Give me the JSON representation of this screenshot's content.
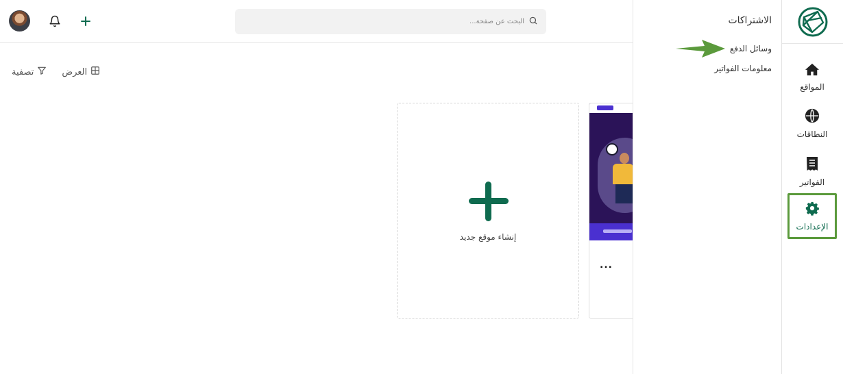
{
  "topbar": {
    "search_placeholder": "البحث عن صفحة..."
  },
  "toolbar": {
    "view_label": "العرض",
    "filter_label": "تصفية"
  },
  "cards": {
    "new_site_label": "إنشاء موقع جديد",
    "more_label": "..."
  },
  "settings_panel": {
    "title": "الاشتراكات",
    "links": [
      {
        "label": "وسائل الدفع"
      },
      {
        "label": "معلومات الفواتير"
      }
    ]
  },
  "nav": {
    "items": [
      {
        "label": "المواقع",
        "icon": "home-icon"
      },
      {
        "label": "النطاقات",
        "icon": "globe-icon"
      },
      {
        "label": "الفواتير",
        "icon": "receipt-icon"
      },
      {
        "label": "الإعدادات",
        "icon": "gear-icon",
        "active": true
      }
    ]
  },
  "colors": {
    "brand": "#0f6b4f",
    "highlight": "#5b9a3c",
    "thumb_bg": "#2b1358",
    "thumb_accent": "#4a30d0"
  }
}
